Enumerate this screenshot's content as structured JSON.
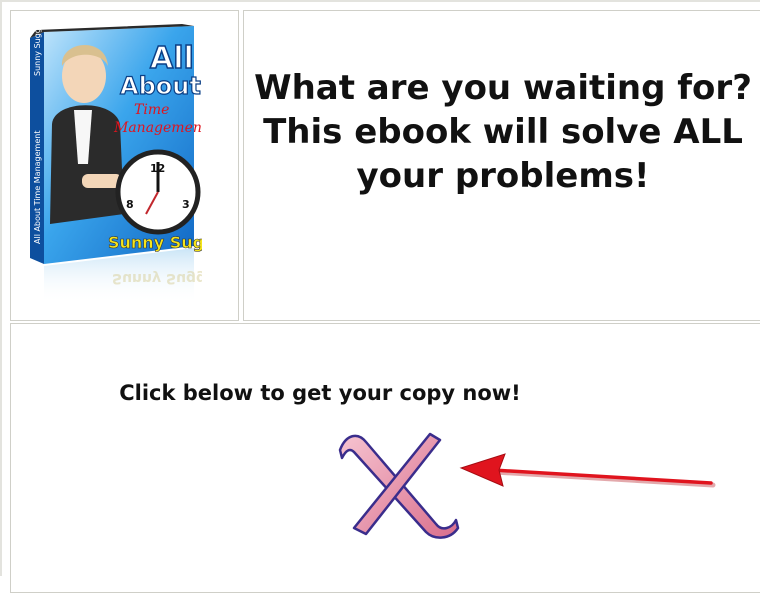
{
  "headline": "What are you waiting for?  This ebook will solve ALL your problems!",
  "cta": {
    "text": "Click below to get your copy now!"
  },
  "ebook": {
    "title_line1": "All",
    "title_line2": "About",
    "title_line3": "Time",
    "title_line4": "Management",
    "author": "Sunny Suggs",
    "spine_author": "Sunny Suggs",
    "spine_title": "All About Time Management"
  },
  "icons": {
    "close": "close-x-icon",
    "arrow": "red-arrow-left-icon"
  },
  "colors": {
    "x_fill": "#e9a0b3",
    "x_stroke": "#3a2d8c",
    "arrow": "#e0141e",
    "cover_blue": "#1f8fe0",
    "cover_yellow": "#f5e51a"
  }
}
